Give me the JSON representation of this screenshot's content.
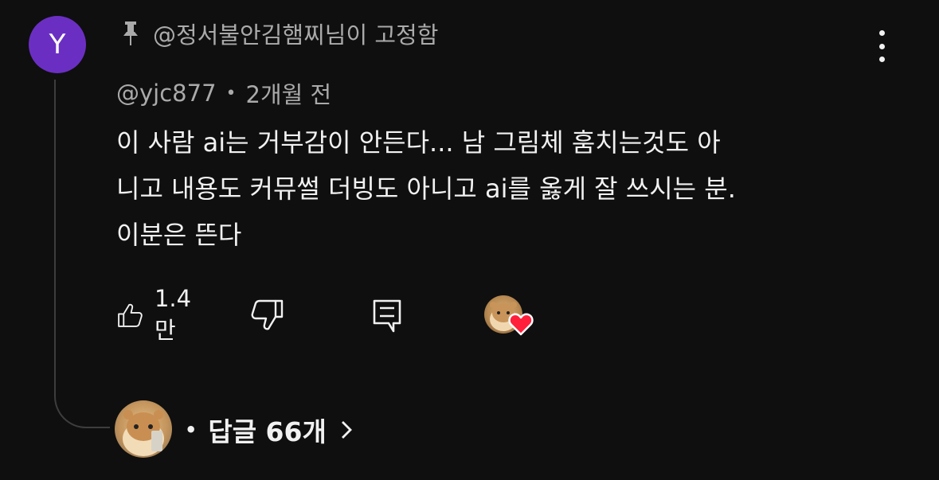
{
  "avatar": {
    "letter": "Y",
    "color": "#6a2fc2"
  },
  "pinned": {
    "label": "@정서불안김햄찌님이 고정함",
    "icon": "pin-icon"
  },
  "comment": {
    "author": "@yjc877",
    "separator": "•",
    "time": "2개월 전",
    "lines": [
      "이 사람 ai는 거부감이 안든다... 남 그림체 훔치는것도 아",
      "니고 내용도 커뮤썰 더빙도 아니고 ai를 옳게 잘 쓰시는 분.",
      "이분은 뜬다"
    ]
  },
  "actions": {
    "like_count": "1.4만",
    "icons": [
      "thumbs-up-icon",
      "thumbs-down-icon",
      "reply-icon",
      "creator-heart-icon"
    ],
    "heart_color": "#ff1f3a"
  },
  "replies": {
    "bullet": "•",
    "label": "답글 66개",
    "chevron": "›"
  },
  "menu": {
    "icon": "more-vert-icon"
  }
}
